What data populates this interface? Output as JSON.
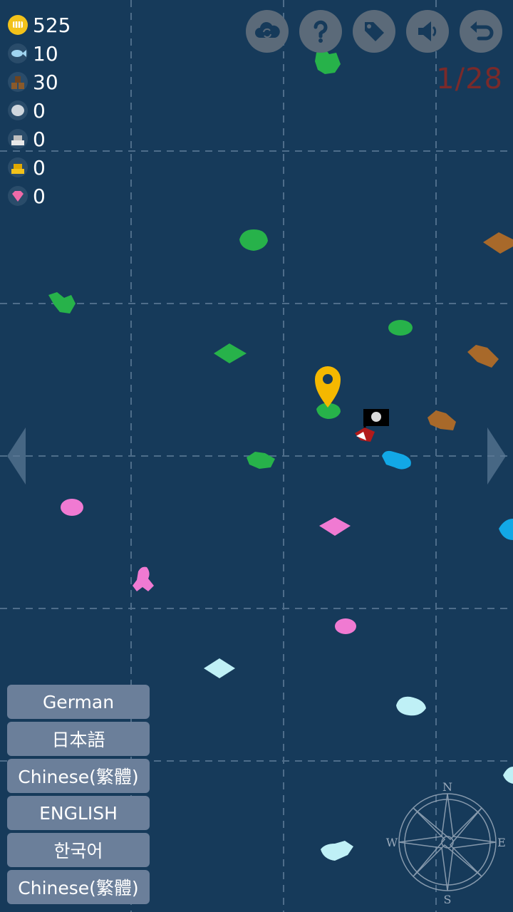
{
  "resources": [
    {
      "icon": "coin-icon",
      "value": "525",
      "color": "#f2c21a"
    },
    {
      "icon": "fish-icon",
      "value": "10",
      "color": "#9fd3ef"
    },
    {
      "icon": "wood-icon",
      "value": "30",
      "color": "#8a5a2b"
    },
    {
      "icon": "stone-icon",
      "value": "0",
      "color": "#cfd6dd"
    },
    {
      "icon": "iron-icon",
      "value": "0",
      "color": "#e8e8e8"
    },
    {
      "icon": "gold-icon",
      "value": "0",
      "color": "#f2c21a"
    },
    {
      "icon": "gem-icon",
      "value": "0",
      "color": "#f06aa8"
    }
  ],
  "toolbar": [
    {
      "icon": "cloud-sync-icon"
    },
    {
      "icon": "help-icon"
    },
    {
      "icon": "tag-icon"
    },
    {
      "icon": "sound-icon"
    },
    {
      "icon": "back-icon"
    }
  ],
  "counter": "1/28",
  "languages": [
    "German",
    "日本語",
    "Chinese(繁體)",
    "ENGLISH",
    "한국어",
    "Chinese(繁體)"
  ],
  "compass": {
    "n": "N",
    "s": "S",
    "e": "E",
    "w": "W"
  },
  "colors": {
    "ocean": "#163a5a",
    "island_green": "#27b24a",
    "island_brown": "#a8692a",
    "island_cyan": "#12a8e6",
    "island_pink": "#f07ad2",
    "island_ice": "#bff0f6",
    "marker": "#f5b800",
    "ui_button": "#5b6a79",
    "lang_button": "#6b7f9a",
    "counter": "#7a2a2a"
  }
}
